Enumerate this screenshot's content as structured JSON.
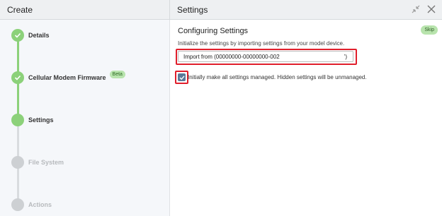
{
  "header": {
    "left_title": "Create",
    "right_title": "Settings",
    "icons": [
      "collapse-arrows-icon",
      "close-icon"
    ]
  },
  "steps": [
    {
      "label": "Details",
      "state": "complete"
    },
    {
      "label": "Cellular Modem Firmware",
      "state": "complete",
      "badge": "Beta"
    },
    {
      "label": "Settings",
      "state": "current"
    },
    {
      "label": "File System",
      "state": "disabled"
    },
    {
      "label": "Actions",
      "state": "disabled"
    }
  ],
  "content": {
    "title": "Configuring Settings",
    "skip_label": "Skip",
    "description": "Initialize the settings by importing settings from your model device.",
    "import_field": {
      "value": "Import from (00000000-00000000-002",
      "suffix": "’)"
    },
    "checkbox": {
      "checked": true,
      "label": "Initially make all settings managed. Hidden settings will be unmanaged."
    }
  },
  "colors": {
    "accent_green": "#8cd17a",
    "highlight_red": "#e01e2b",
    "checkbox_blue": "#5b7a99"
  }
}
